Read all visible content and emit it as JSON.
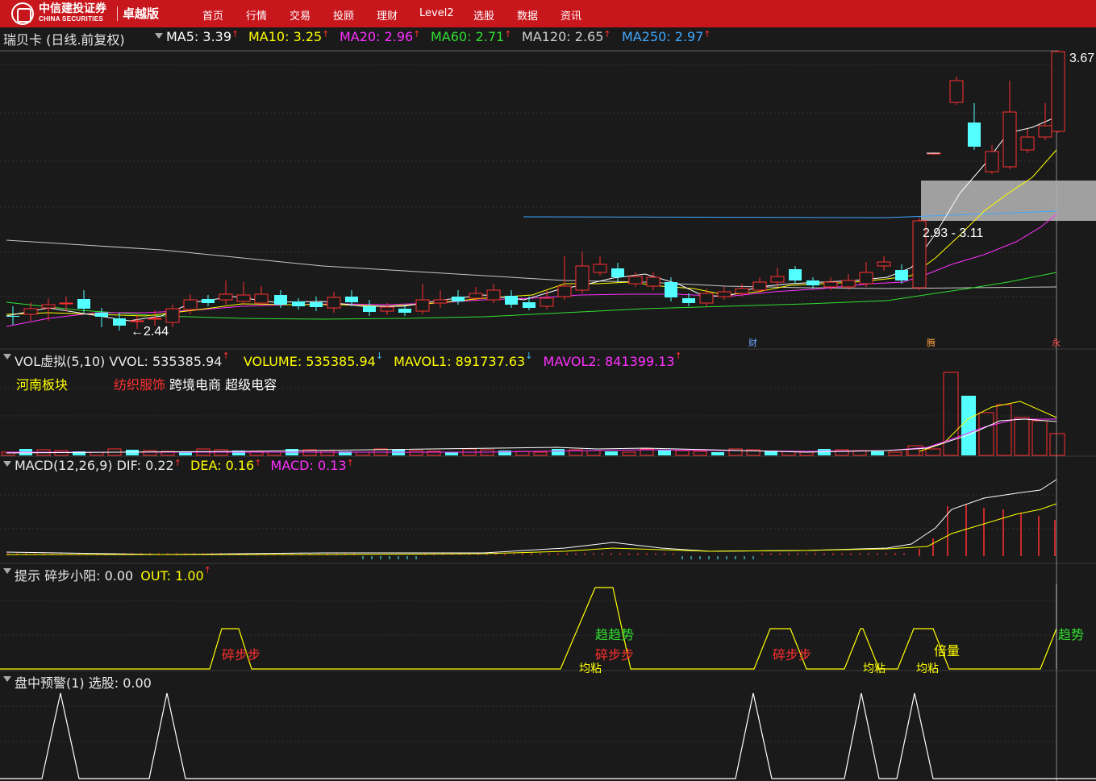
{
  "app": {
    "brand_cn": "中信建投证券",
    "brand_en": "CHINA SECURITIES",
    "edition": "卓越版",
    "nav": [
      "首页",
      "行情",
      "交易",
      "投顾",
      "理财",
      "Level2",
      "选股",
      "数据",
      "资讯"
    ]
  },
  "stock": {
    "title": "瑞贝卡 (日线.前复权)",
    "ma": [
      {
        "label": "MA5: 3.39",
        "color": "#ffffff"
      },
      {
        "label": "MA10: 3.25",
        "color": "#ffff00"
      },
      {
        "label": "MA20: 2.96",
        "color": "#ff30ff"
      },
      {
        "label": "MA60: 2.71",
        "color": "#30e030"
      },
      {
        "label": "MA120: 2.65",
        "color": "#d0d0d0"
      },
      {
        "label": "MA250: 2.97",
        "color": "#3fa8ff"
      }
    ],
    "high_label": "3.67",
    "low_label": "2.44",
    "range_label": "2.93 - 3.11",
    "markers": [
      "财",
      "腾",
      "永"
    ]
  },
  "vol": {
    "title": "VOL虚拟(5,10) VVOL: 535385.94",
    "volume": "VOLUME: 535385.94",
    "mavol1": "MAVOL1: 891737.63",
    "mavol2": "MAVOL2: 841399.13",
    "tags": [
      {
        "text": "河南板块",
        "color": "#ffff00"
      },
      {
        "text": "纺织服饰",
        "color": "#ff3030"
      },
      {
        "text": "跨境电商 超级电容",
        "color": "#ffffff"
      }
    ]
  },
  "macd": {
    "title": "MACD(12,26,9) DIF: 0.22",
    "dea": "DEA: 0.16",
    "macd": "MACD: 0.13"
  },
  "hint": {
    "title": "提示 碎步小阳: 0.00",
    "out": "OUT: 1.00",
    "labels": [
      {
        "text": "碎步步",
        "color": "#ff3030"
      },
      {
        "text": "趋趋势",
        "color": "#30e030"
      },
      {
        "text": "碎步步",
        "color": "#ff3030"
      },
      {
        "text": "均粘",
        "color": "#ffff00"
      },
      {
        "text": "碎步步",
        "color": "#ff3030"
      },
      {
        "text": "均粘",
        "color": "#ffff00"
      },
      {
        "text": "均粘",
        "color": "#ffff00"
      },
      {
        "text": "倍量",
        "color": "#ffff00"
      },
      {
        "text": "趋势",
        "color": "#30e030"
      }
    ]
  },
  "alert": {
    "title": "盘中预警(1) 选股: 0.00"
  }
}
